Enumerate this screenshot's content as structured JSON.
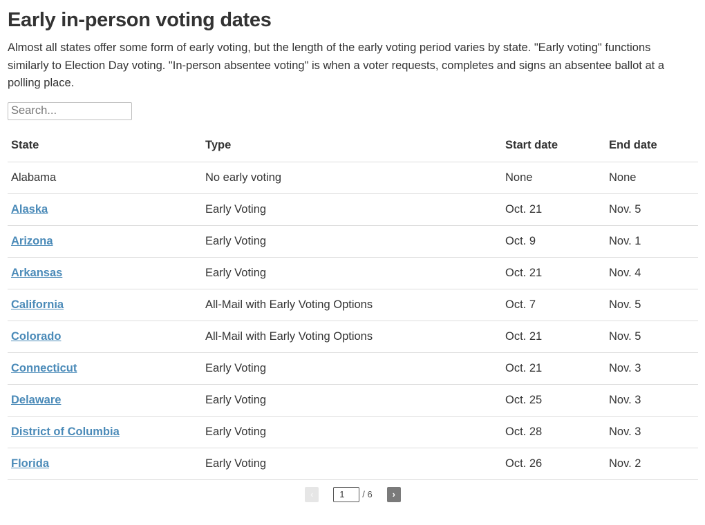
{
  "title": "Early in-person voting dates",
  "description": "Almost all states offer some form of early voting, but the length of the early voting period varies by state. \"Early voting\" functions similarly to Election Day voting. \"In-person absentee voting\" is when a voter requests, completes and signs an absentee ballot at a polling place.",
  "search": {
    "placeholder": "Search...",
    "value": ""
  },
  "table": {
    "headers": [
      "State",
      "Type",
      "Start date",
      "End date"
    ],
    "rows": [
      {
        "state": "Alabama",
        "link": false,
        "type": "No early voting",
        "start": "None",
        "end": "None"
      },
      {
        "state": "Alaska",
        "link": true,
        "type": "Early Voting",
        "start": "Oct. 21",
        "end": "Nov. 5"
      },
      {
        "state": "Arizona",
        "link": true,
        "type": "Early Voting",
        "start": "Oct. 9",
        "end": "Nov. 1"
      },
      {
        "state": "Arkansas",
        "link": true,
        "type": "Early Voting",
        "start": "Oct. 21",
        "end": "Nov. 4"
      },
      {
        "state": "California",
        "link": true,
        "type": "All-Mail with Early Voting Options",
        "start": "Oct. 7",
        "end": "Nov. 5"
      },
      {
        "state": "Colorado",
        "link": true,
        "type": "All-Mail with Early Voting Options",
        "start": "Oct. 21",
        "end": "Nov. 5"
      },
      {
        "state": "Connecticut",
        "link": true,
        "type": "Early Voting",
        "start": "Oct. 21",
        "end": "Nov. 3"
      },
      {
        "state": "Delaware",
        "link": true,
        "type": "Early Voting",
        "start": "Oct. 25",
        "end": "Nov. 3"
      },
      {
        "state": "District of Columbia",
        "link": true,
        "type": "Early Voting",
        "start": "Oct. 28",
        "end": "Nov. 3"
      },
      {
        "state": "Florida",
        "link": true,
        "type": "Early Voting",
        "start": "Oct. 26",
        "end": "Nov. 2"
      }
    ]
  },
  "pagination": {
    "prev_icon": "‹",
    "next_icon": "›",
    "current_page": "1",
    "total_label": "/ 6"
  },
  "colors": {
    "link": "#4a8ab8",
    "text": "#333333",
    "divider": "#dddddd"
  }
}
